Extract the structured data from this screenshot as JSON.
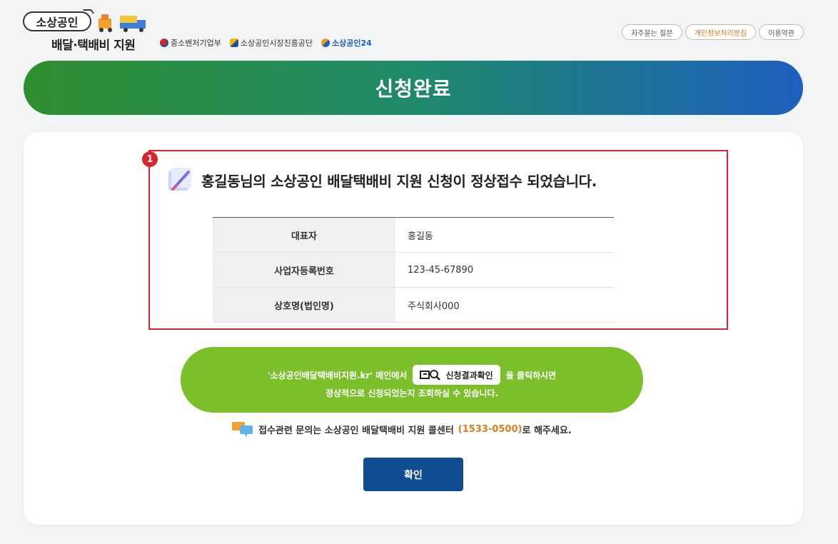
{
  "header": {
    "logo_main": "소상공인",
    "logo_sub": "배달·택배비 지원",
    "partners": [
      "중소벤처기업부",
      "소상공인시장진흥공단",
      "소상공인24"
    ],
    "top_links": [
      "자주묻는 질문",
      "개인정보처리방침",
      "이용약관"
    ]
  },
  "banner": {
    "title": "신청완료"
  },
  "result": {
    "badge": "1",
    "message": "홍길동님의 소상공인 배달택배비 지원 신청이 정상접수 되었습니다.",
    "rows": [
      {
        "label": "대표자",
        "value": "홍길동"
      },
      {
        "label": "사업자등록번호",
        "value": "123-45-67890"
      },
      {
        "label": "상호명(법인명)",
        "value": "주식회사000"
      }
    ]
  },
  "notice": {
    "prefix": "'소상공인배달택배비지원.kr' 메인에서",
    "button_label": "신청결과확인",
    "suffix": "을 클릭하시면",
    "line2": "정상적으로 신청되었는지 조회하실 수 있습니다."
  },
  "contact": {
    "text": "접수관련 문의는 소상공인 배달택배비 지원 콜센터",
    "phone": "(1533-0500)",
    "tail": "로 해주세요."
  },
  "confirm_label": "확인",
  "colors": {
    "accent_red": "#d9232d",
    "green": "#7bbf2a",
    "navy": "#0f4c91",
    "orange": "#e07a1f"
  }
}
